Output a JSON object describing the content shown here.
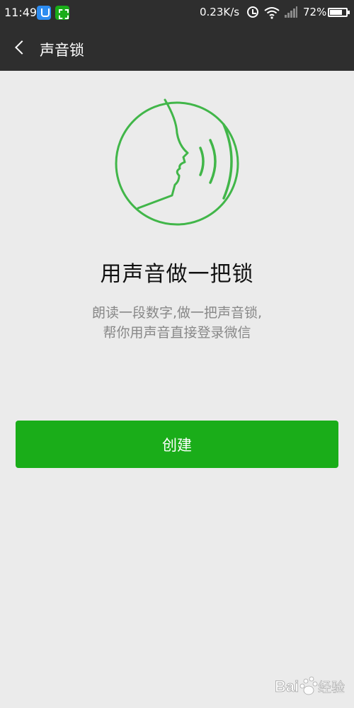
{
  "status_bar": {
    "time": "11:49",
    "network_speed": "0.23K/s",
    "battery_percent": "72%",
    "icons": [
      "app-notification-icon",
      "app-scan-icon",
      "alarm-icon",
      "wifi-icon",
      "signal-icon",
      "battery-icon"
    ]
  },
  "nav": {
    "back_icon": "chevron-left-icon",
    "title": "声音锁"
  },
  "content": {
    "illustration": "face-voice-icon",
    "heading": "用声音做一把锁",
    "desc_line1": "朗读一段数字,做一把声音锁,",
    "desc_line2": "帮你用声音直接登录微信"
  },
  "create_button": {
    "label": "创建"
  },
  "watermark": {
    "text": "Bai 经验"
  },
  "colors": {
    "accent": "#1aad19",
    "header_bg": "#2e2e2e",
    "page_bg": "#ebebeb",
    "desc_text": "#888888"
  }
}
